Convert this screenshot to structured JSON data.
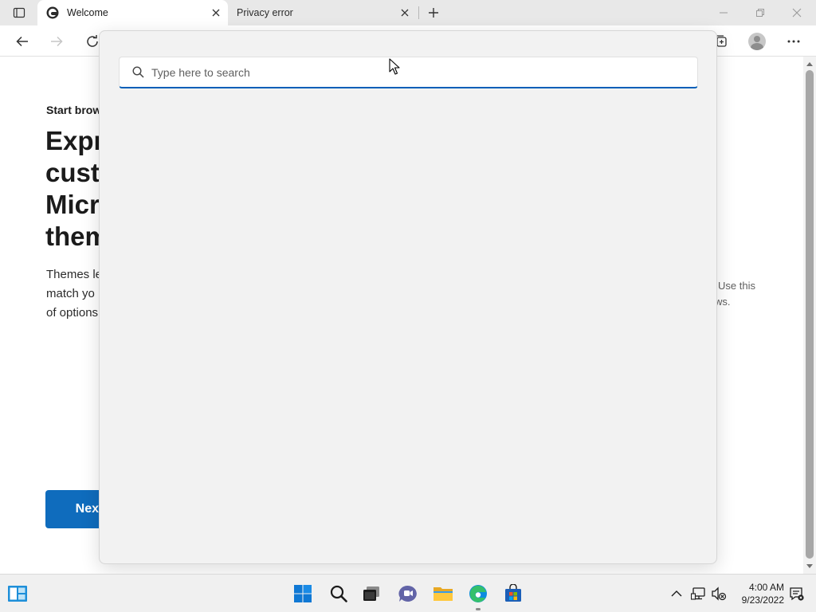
{
  "browser": {
    "tabs": [
      {
        "title": "Welcome",
        "active": true
      },
      {
        "title": "Privacy error",
        "active": false
      }
    ]
  },
  "page": {
    "eyebrow": "Start brow",
    "headline_lines": [
      "Expre",
      "custo",
      "Micro",
      "them"
    ],
    "description_lines": [
      "Themes le",
      "match yo",
      "of options"
    ],
    "right_text_lines": [
      "Use this",
      "ws."
    ],
    "next_label": "Next"
  },
  "search": {
    "placeholder": "Type here to search",
    "value": ""
  },
  "taskbar": {
    "time": "4:00 AM",
    "date": "9/23/2022"
  },
  "colors": {
    "accent": "#0f6cbd",
    "search_underline": "#005fb8",
    "panel_bg": "#f2f2f2",
    "tabstrip_bg": "#e8e8e8",
    "taskbar_bg": "#f0f0f0"
  },
  "icons": {
    "tab_actions": "tab-actions-icon",
    "welcome_favicon": "edge-icon",
    "tab_close": "close-icon",
    "new_tab": "plus-icon",
    "back": "back-arrow-icon",
    "forward": "forward-arrow-icon",
    "refresh": "refresh-icon",
    "collections": "collections-icon",
    "profile": "profile-icon",
    "menu": "more-icon",
    "search": "search-icon",
    "start": "windows-start-icon",
    "task_view": "task-view-icon",
    "chat": "chat-icon",
    "explorer": "file-explorer-icon",
    "edge": "edge-icon",
    "store": "store-icon",
    "tray_chevron": "chevron-up-icon",
    "network": "network-icon",
    "volume": "volume-muted-icon",
    "notification": "notification-icon",
    "widgets": "widgets-icon"
  }
}
